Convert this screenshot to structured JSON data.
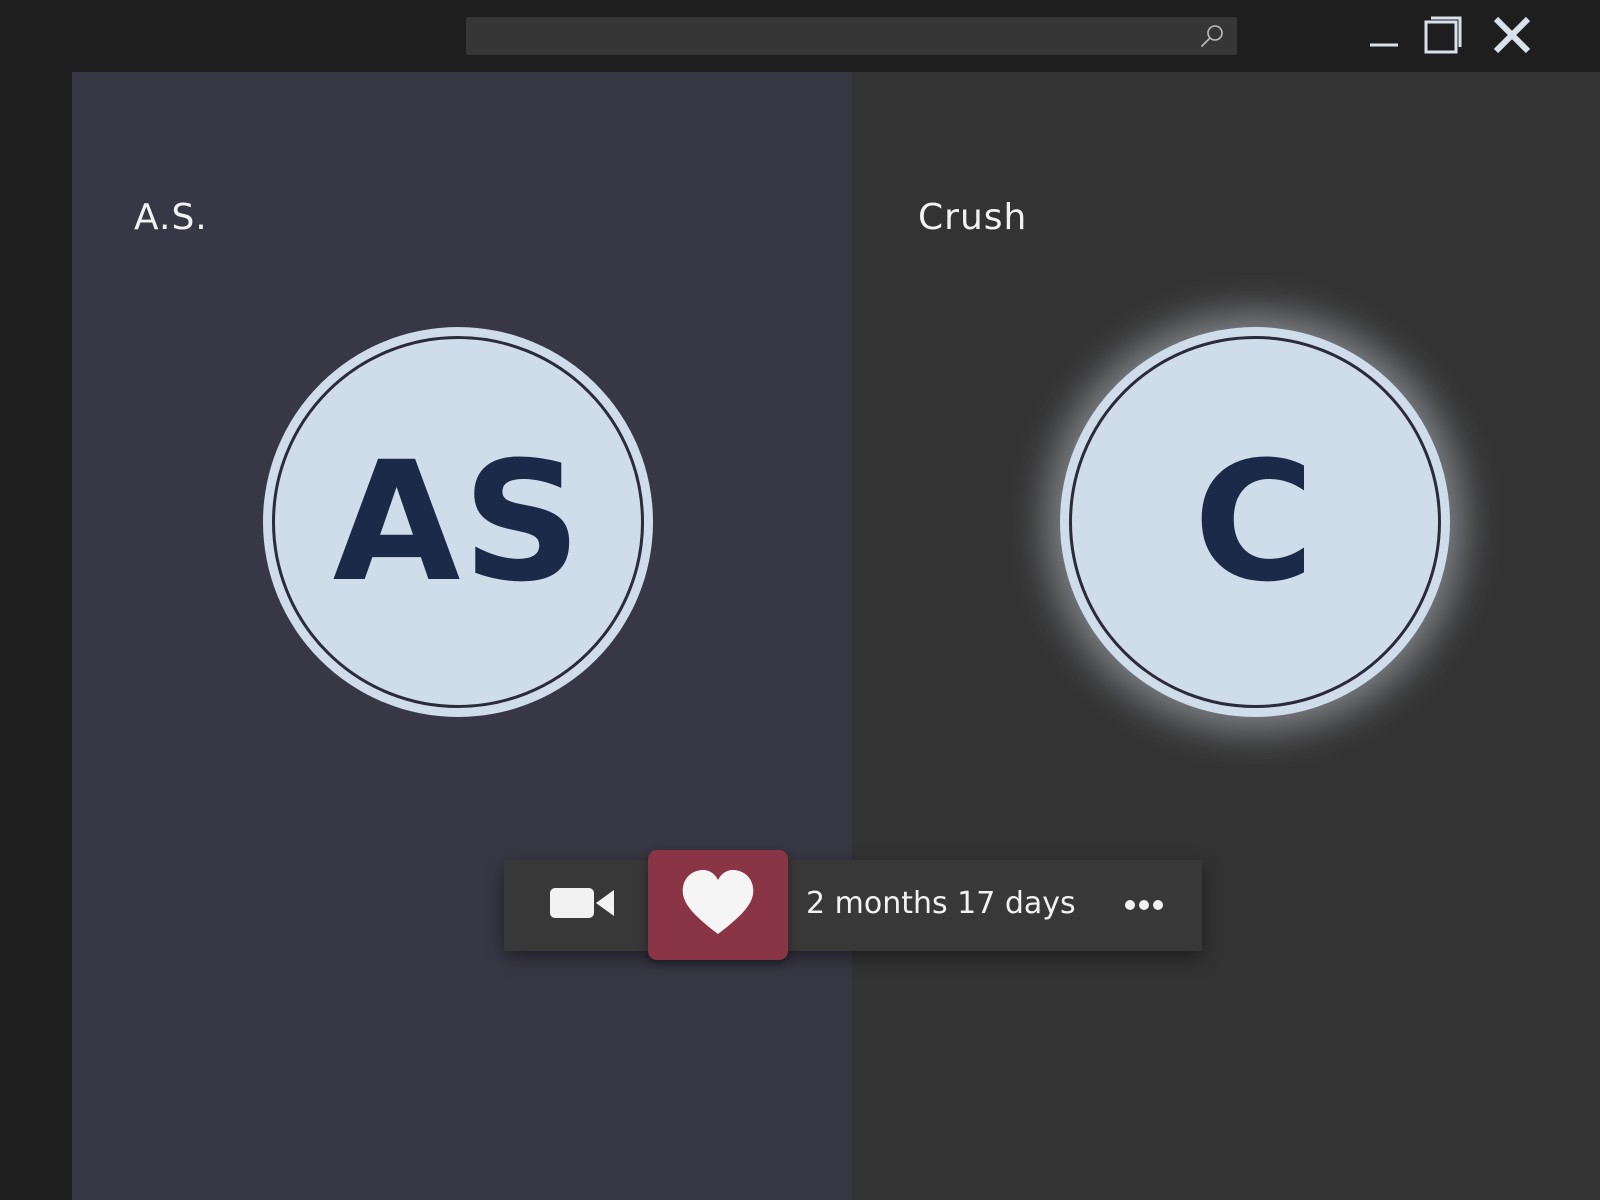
{
  "search": {
    "value": "",
    "placeholder": "",
    "icon": "search-icon"
  },
  "window_controls": {
    "minimize_icon": "minimize-icon",
    "maximize_icon": "maximize-icon",
    "close_icon": "close-icon"
  },
  "participants": {
    "left": {
      "name": "A.S.",
      "initials": "AS"
    },
    "right": {
      "name": "Crush",
      "initials": "C"
    }
  },
  "action_bar": {
    "video_icon": "video-camera-icon",
    "heart_icon": "heart-icon",
    "duration": "2 months 17 days",
    "more_icon": "more-options-icon"
  },
  "colors": {
    "left_panel": "#383745",
    "right_panel": "#333333",
    "avatar_fill": "#cfdce9",
    "initials": "#1a2a48",
    "heart_accent": "#8a3545"
  }
}
